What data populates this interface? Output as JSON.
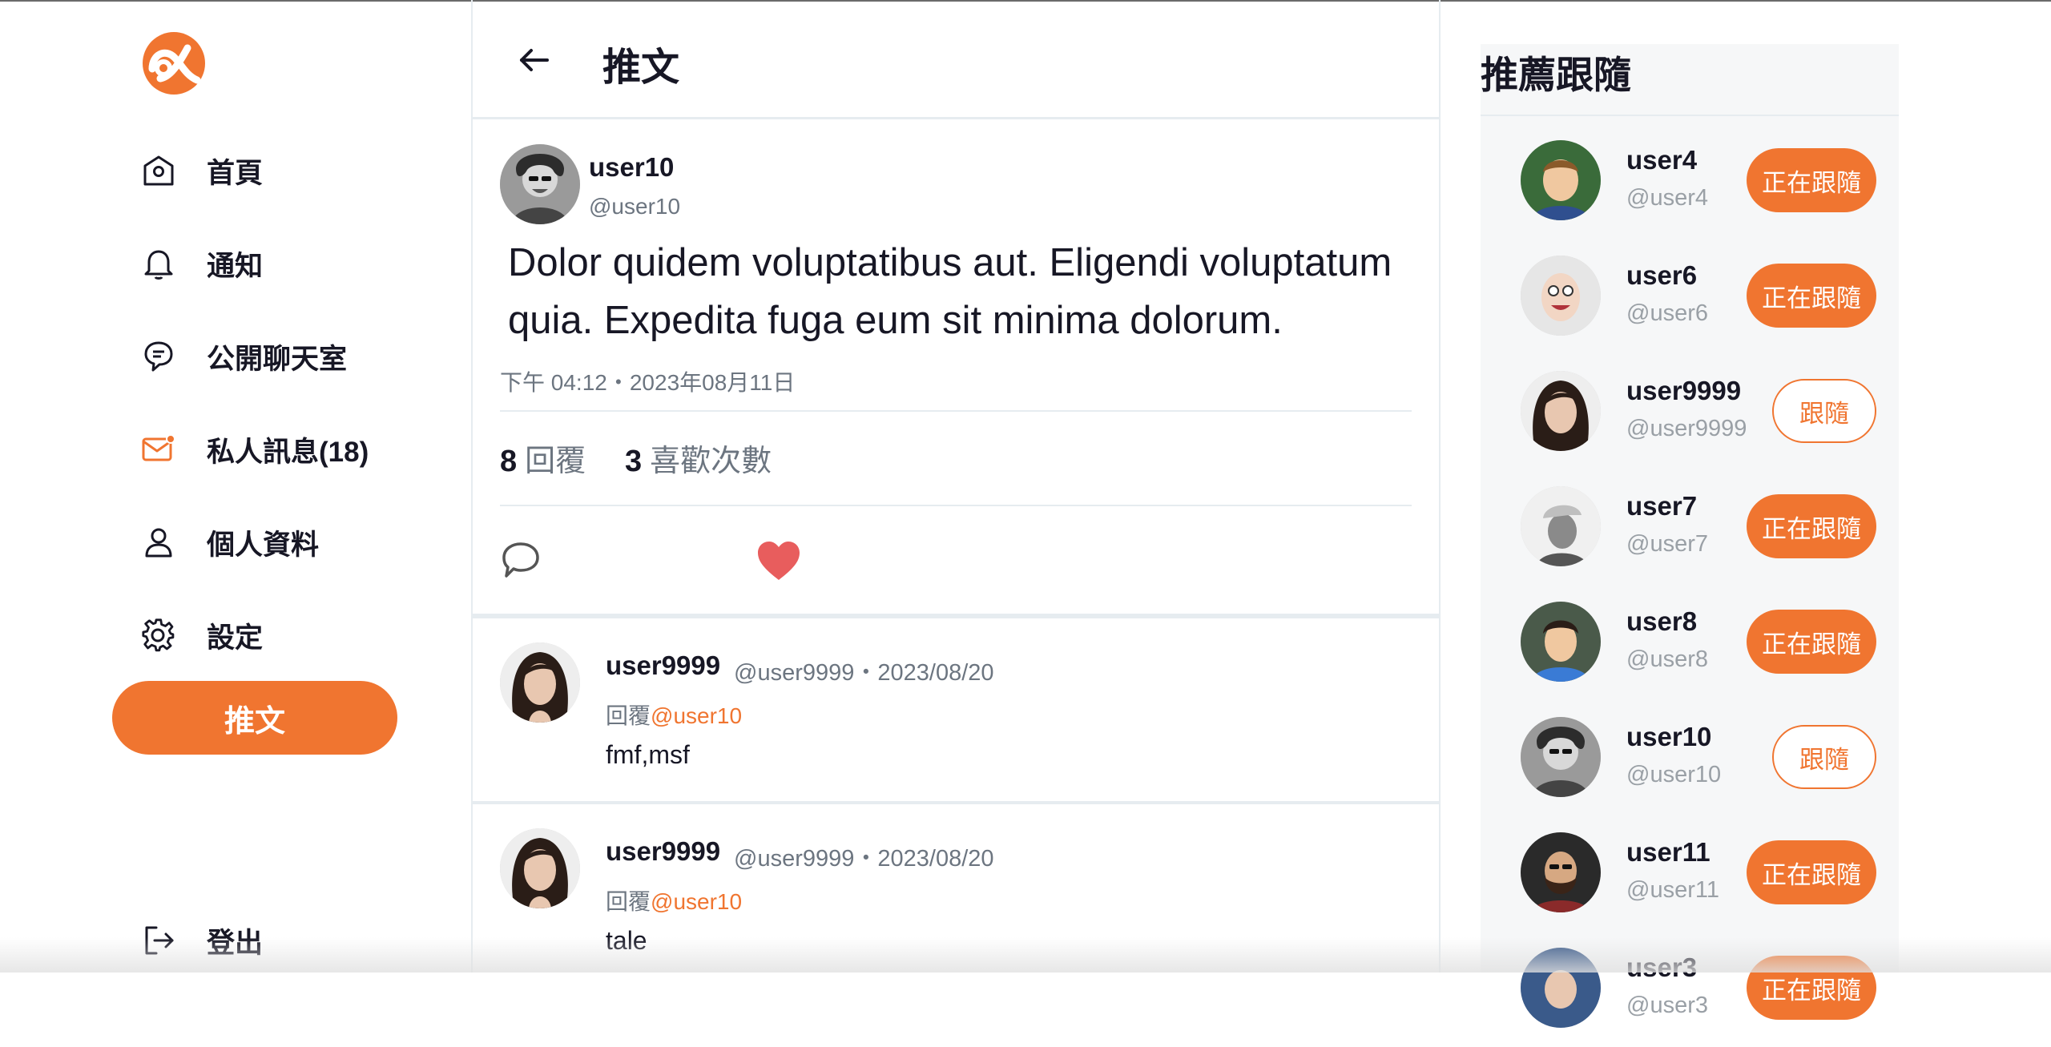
{
  "sidebar": {
    "nav": [
      {
        "label": "首頁",
        "icon": "home-icon"
      },
      {
        "label": "通知",
        "icon": "bell-icon"
      },
      {
        "label": "公開聊天室",
        "icon": "chat-icon"
      },
      {
        "label": "私人訊息(18)",
        "icon": "mail-icon"
      },
      {
        "label": "個人資料",
        "icon": "user-icon"
      },
      {
        "label": "設定",
        "icon": "gear-icon"
      }
    ],
    "tweet_button": "推文",
    "logout_label": "登出"
  },
  "header": {
    "title": "推文"
  },
  "post": {
    "name": "user10",
    "handle": "@user10",
    "body": "Dolor quidem voluptatibus aut. Eligendi voluptatum quia. Expedita fuga eum sit minima dolorum.",
    "time": "下午 04:12・2023年08月11日",
    "reply_count": "8",
    "reply_label": "回覆",
    "like_count": "3",
    "like_label": "喜歡次數"
  },
  "replies": [
    {
      "name": "user9999",
      "meta": "@user9999・2023/08/20",
      "to_prefix": "回覆",
      "to_handle": "@user10",
      "text": "fmf,msf"
    },
    {
      "name": "user9999",
      "meta": "@user9999・2023/08/20",
      "to_prefix": "回覆",
      "to_handle": "@user10",
      "text": "tale"
    }
  ],
  "suggestions": {
    "title": "推薦跟隨",
    "items": [
      {
        "name": "user4",
        "handle": "@user4",
        "button": "正在跟隨",
        "following": true
      },
      {
        "name": "user6",
        "handle": "@user6",
        "button": "正在跟隨",
        "following": true
      },
      {
        "name": "user9999",
        "handle": "@user9999",
        "button": "跟隨",
        "following": false
      },
      {
        "name": "user7",
        "handle": "@user7",
        "button": "正在跟隨",
        "following": true
      },
      {
        "name": "user8",
        "handle": "@user8",
        "button": "正在跟隨",
        "following": true
      },
      {
        "name": "user10",
        "handle": "@user10",
        "button": "跟隨",
        "following": false
      },
      {
        "name": "user11",
        "handle": "@user11",
        "button": "正在跟隨",
        "following": true
      },
      {
        "name": "user3",
        "handle": "@user3",
        "button": "正在跟隨",
        "following": true
      }
    ]
  },
  "colors": {
    "accent": "#f07530",
    "like": "#e85d5d",
    "muted": "#6c7580"
  }
}
